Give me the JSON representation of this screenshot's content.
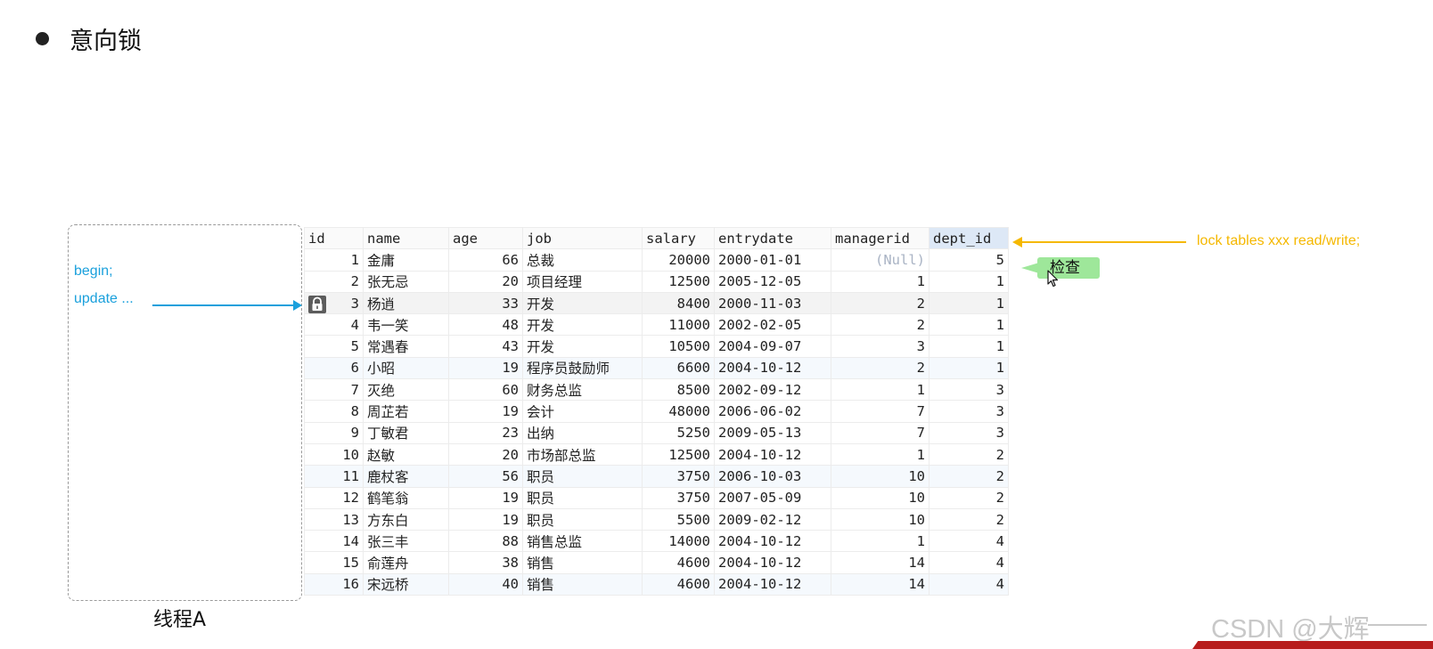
{
  "slide": {
    "title": "意向锁"
  },
  "thread_a": {
    "code_lines": [
      "begin;",
      "update ..."
    ],
    "label": "线程A"
  },
  "annotation": {
    "text": "lock tables xxx read/write;",
    "check_label": "检查"
  },
  "colors": {
    "blue": "#1aa0dc",
    "orange": "#f5b800",
    "green": "#9ee79a",
    "null_text": "#a9b3c4"
  },
  "table": {
    "columns": [
      "id",
      "name",
      "age",
      "job",
      "salary",
      "entrydate",
      "managerid",
      "dept_id"
    ],
    "rows": [
      [
        "1",
        "金庸",
        "66",
        "总裁",
        "20000",
        "2000-01-01",
        "(Null)",
        "5"
      ],
      [
        "2",
        "张无忌",
        "20",
        "项目经理",
        "12500",
        "2005-12-05",
        "1",
        "1"
      ],
      [
        "3",
        "杨逍",
        "33",
        "开发",
        "8400",
        "2000-11-03",
        "2",
        "1"
      ],
      [
        "4",
        "韦一笑",
        "48",
        "开发",
        "11000",
        "2002-02-05",
        "2",
        "1"
      ],
      [
        "5",
        "常遇春",
        "43",
        "开发",
        "10500",
        "2004-09-07",
        "3",
        "1"
      ],
      [
        "6",
        "小昭",
        "19",
        "程序员鼓励师",
        "6600",
        "2004-10-12",
        "2",
        "1"
      ],
      [
        "7",
        "灭绝",
        "60",
        "财务总监",
        "8500",
        "2002-09-12",
        "1",
        "3"
      ],
      [
        "8",
        "周芷若",
        "19",
        "会计",
        "48000",
        "2006-06-02",
        "7",
        "3"
      ],
      [
        "9",
        "丁敏君",
        "23",
        "出纳",
        "5250",
        "2009-05-13",
        "7",
        "3"
      ],
      [
        "10",
        "赵敏",
        "20",
        "市场部总监",
        "12500",
        "2004-10-12",
        "1",
        "2"
      ],
      [
        "11",
        "鹿杖客",
        "56",
        "职员",
        "3750",
        "2006-10-03",
        "10",
        "2"
      ],
      [
        "12",
        "鹤笔翁",
        "19",
        "职员",
        "3750",
        "2007-05-09",
        "10",
        "2"
      ],
      [
        "13",
        "方东白",
        "19",
        "职员",
        "5500",
        "2009-02-12",
        "10",
        "2"
      ],
      [
        "14",
        "张三丰",
        "88",
        "销售总监",
        "14000",
        "2004-10-12",
        "1",
        "4"
      ],
      [
        "15",
        "俞莲舟",
        "38",
        "销售",
        "4600",
        "2004-10-12",
        "14",
        "4"
      ],
      [
        "16",
        "宋远桥",
        "40",
        "销售",
        "4600",
        "2004-10-12",
        "14",
        "4"
      ]
    ],
    "locked_row_id": "3",
    "active_column": "dept_id"
  },
  "watermark": {
    "text": "CSDN @大辉"
  }
}
